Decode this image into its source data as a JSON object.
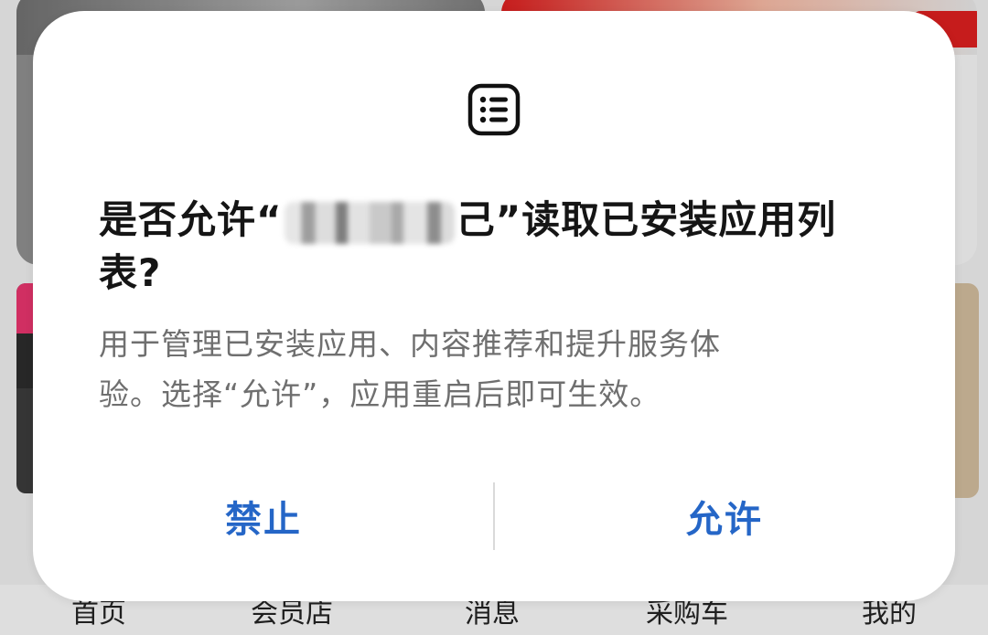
{
  "background": {
    "banner_text": "",
    "nav": [
      "首页",
      "会员店",
      "消息",
      "采购车",
      "我的"
    ]
  },
  "dialog": {
    "icon": "list-icon",
    "title_prefix": "是否允许“",
    "title_suffix_char": "己",
    "title_after": "”读取已安装应用列",
    "title_line2": "表?",
    "description_line1": "用于管理已安装应用、内容推荐和提升服务体",
    "description_line2": "验。选择“允许”，应用重启后即可生效。",
    "deny_label": "禁止",
    "allow_label": "允许"
  },
  "colors": {
    "button_text": "#2566c7",
    "title_text": "#151515",
    "description_text": "#6f6f6f",
    "dialog_bg": "#ffffff"
  }
}
